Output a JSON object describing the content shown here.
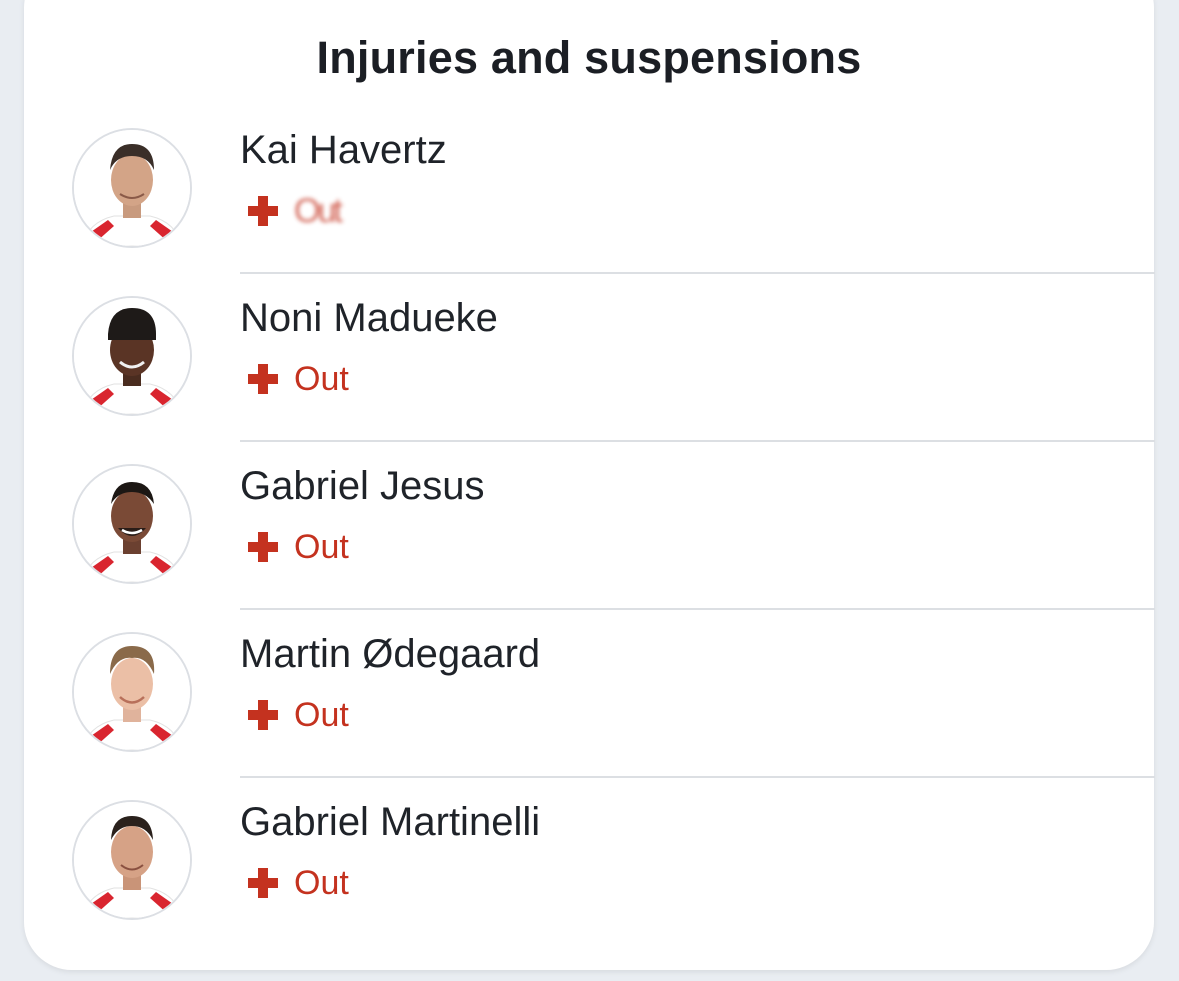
{
  "header": {
    "title": "Injuries and suspensions"
  },
  "players": [
    {
      "name": "Kai Havertz",
      "status": "Out",
      "status_obscured": true,
      "avatar_icon": "player-avatar"
    },
    {
      "name": "Noni Madueke",
      "status": "Out",
      "status_obscured": false,
      "avatar_icon": "player-avatar"
    },
    {
      "name": "Gabriel Jesus",
      "status": "Out",
      "status_obscured": false,
      "avatar_icon": "player-avatar"
    },
    {
      "name": "Martin Ødegaard",
      "status": "Out",
      "status_obscured": false,
      "avatar_icon": "player-avatar"
    },
    {
      "name": "Gabriel Martinelli",
      "status": "Out",
      "status_obscured": false,
      "avatar_icon": "player-avatar"
    }
  ],
  "icons": {
    "status": "medical-cross-icon"
  },
  "colors": {
    "status_red": "#c4321f",
    "name_text": "#1f2329",
    "kit_red": "#d9252f",
    "background": "#e9edf2"
  }
}
